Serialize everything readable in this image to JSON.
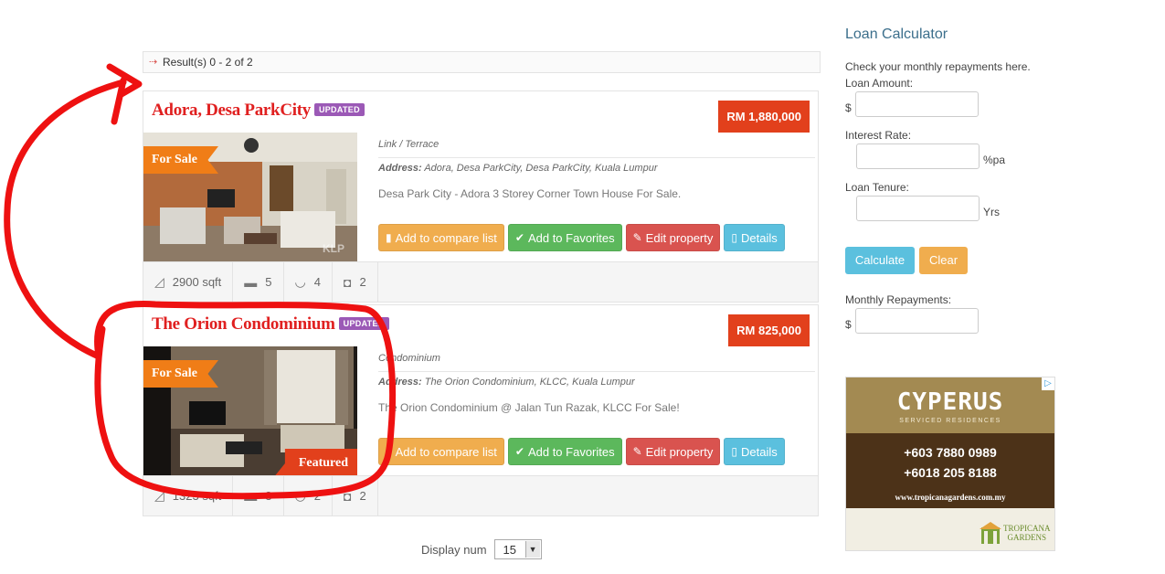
{
  "results": {
    "text": "Result(s) 0 - 2 of 2"
  },
  "listings": [
    {
      "title": "Adora, Desa ParkCity",
      "badge": "UPDATED",
      "price": "RM 1,880,000",
      "ribbon": "For Sale",
      "watermark": "KLP",
      "type": "Link / Terrace",
      "address_label": "Address:",
      "address": "Adora, Desa ParkCity, Desa ParkCity, Kuala Lumpur",
      "description": "Desa Park City - Adora 3 Storey Corner Town House For Sale.",
      "size": "2900 sqft",
      "beds": "5",
      "baths": "4",
      "parking": "2"
    },
    {
      "title": "The Orion Condominium",
      "badge": "UPDATED",
      "price": "RM 825,000",
      "ribbon": "For Sale",
      "featured": "Featured",
      "type": "Condominium",
      "address_label": "Address:",
      "address": "The Orion Condominium, KLCC, Kuala Lumpur",
      "description": "The Orion Condominium @ Jalan Tun Razak, KLCC For Sale!",
      "size": "1323 sqft",
      "beds": "3",
      "baths": "2",
      "parking": "2"
    }
  ],
  "buttons": {
    "compare": "Add to compare list",
    "favorites": "Add to Favorites",
    "edit": "Edit property",
    "details": "Details"
  },
  "display": {
    "label": "Display num",
    "value": "15"
  },
  "calculator": {
    "title": "Loan Calculator",
    "intro": "Check your monthly repayments here.",
    "loan_amount_label": "Loan Amount:",
    "currency": "$",
    "interest_label": "Interest Rate:",
    "interest_unit": "%pa",
    "tenure_label": "Loan Tenure:",
    "tenure_unit": "Yrs",
    "calculate": "Calculate",
    "clear": "Clear",
    "monthly_label": "Monthly Repayments:"
  },
  "ad": {
    "logo": "CYPERUS",
    "subtitle": "SERVICED RESIDENCES",
    "phone1": "+603 7880 0989",
    "phone2": "+6018 205 8188",
    "url": "www.tropicanagardens.com.my",
    "brand_line1": "TROPICANA",
    "brand_line2": "GARDENS"
  },
  "colors": {
    "title_red": "#e02020",
    "price_red": "#e2401c",
    "ribbon_orange": "#f07d17",
    "badge_purple": "#9b59b6",
    "btn_orange": "#f0ad4e",
    "btn_green": "#5cb85c",
    "btn_red": "#d9534f",
    "btn_blue": "#5bc0de",
    "calc_title": "#3c6f8c",
    "annotation_red": "#ee1111"
  },
  "icons": {
    "results_arrow": "arrow-right-icon",
    "compare": "bookmark-icon",
    "favorites": "check-icon",
    "edit": "edit-icon",
    "details": "document-icon",
    "size": "area-icon",
    "beds": "bed-icon",
    "baths": "bath-icon",
    "parking": "car-icon"
  }
}
